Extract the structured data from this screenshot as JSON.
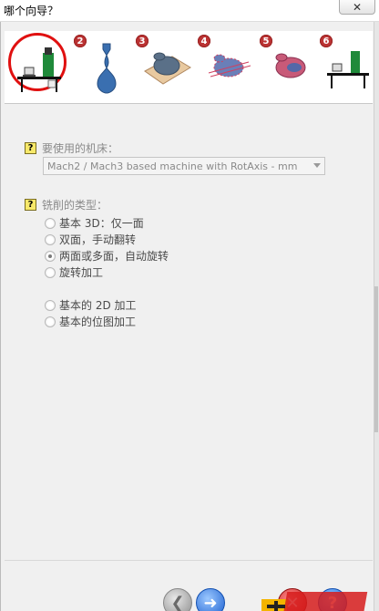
{
  "window": {
    "title": "哪个向导？",
    "close_label": "✕"
  },
  "steps": [
    {
      "number": "",
      "icon": "machine-icon",
      "active": true
    },
    {
      "number": "2",
      "icon": "vase-icon",
      "active": false
    },
    {
      "number": "3",
      "icon": "vase-block-icon",
      "active": false
    },
    {
      "number": "4",
      "icon": "vase-wire-icon",
      "active": false
    },
    {
      "number": "5",
      "icon": "vase-shaded-icon",
      "active": false
    },
    {
      "number": "6",
      "icon": "machine-small-icon",
      "active": false
    }
  ],
  "machine": {
    "help": "?",
    "label": "要使用的机床：",
    "selected": "Mach2 / Mach3 based machine with RotAxis - mm"
  },
  "milling": {
    "help": "?",
    "label": "铣削的类型：",
    "options": [
      {
        "label": "基本 3D：仅一面",
        "checked": false
      },
      {
        "label": "双面，手动翻转",
        "checked": false
      },
      {
        "label": "两面或多面，自动旋转",
        "checked": true
      },
      {
        "label": "旋转加工",
        "checked": false
      },
      {
        "label": "基本的 2D 加工",
        "checked": false
      },
      {
        "label": "基本的位图加工",
        "checked": false
      }
    ]
  },
  "nav": {
    "back_label": "❮",
    "forward_label": "➜",
    "finish_label": "✕",
    "help_label": "?"
  },
  "colors": {
    "accent_ring": "#e01010",
    "step_badge": "#b33333",
    "forward_blue": "#1a5fd0"
  }
}
